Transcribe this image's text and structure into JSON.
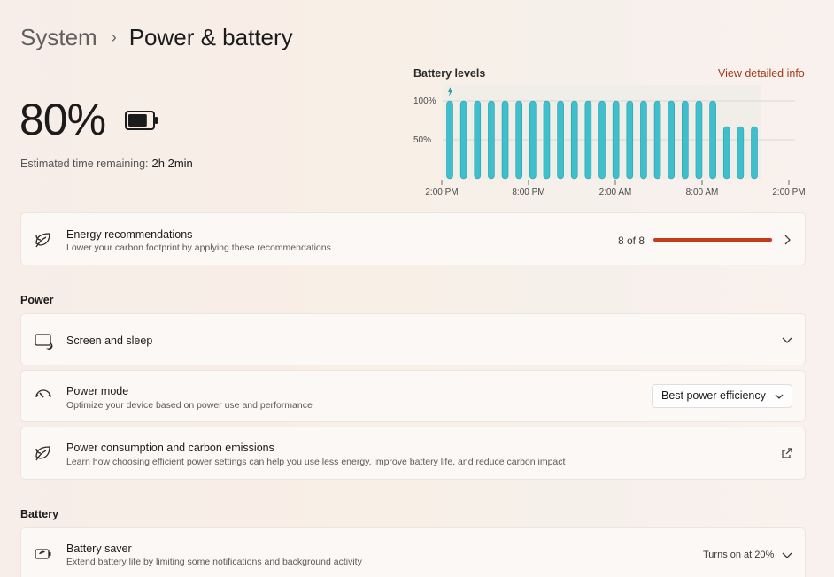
{
  "breadcrumb": {
    "parent": "System",
    "separator": "›",
    "current": "Power & battery"
  },
  "battery": {
    "percent_label": "80%",
    "level": 0.8,
    "estimate_label": "Estimated time remaining:",
    "estimate_value": "2h 2min"
  },
  "battery_chart": {
    "title": "Battery levels",
    "link": "View detailed info"
  },
  "chart_data": {
    "type": "bar",
    "title": "Battery levels",
    "xlabel": "",
    "ylabel": "",
    "ylim": [
      0,
      100
    ],
    "yticks": [
      "100%",
      "50%"
    ],
    "xticks": [
      "2:00 PM",
      "8:00 PM",
      "2:00 AM",
      "8:00 AM",
      "2:00 PM"
    ],
    "charging_marker": "first-bar",
    "color": "#3fbfcb",
    "values": [
      100,
      100,
      100,
      100,
      100,
      100,
      100,
      100,
      100,
      100,
      100,
      100,
      100,
      100,
      100,
      100,
      100,
      100,
      100,
      100,
      67,
      67,
      67
    ],
    "grid": true
  },
  "energy_recommendations": {
    "title": "Energy recommendations",
    "subtitle": "Lower your carbon footprint by applying these recommendations",
    "progress_label": "8 of 8",
    "progress": 1.0,
    "accent": "#c63a1b"
  },
  "power_section": {
    "label": "Power",
    "screen_sleep": {
      "title": "Screen and sleep"
    },
    "power_mode": {
      "title": "Power mode",
      "subtitle": "Optimize your device based on power use and performance",
      "selected": "Best power efficiency"
    },
    "consumption": {
      "title": "Power consumption and carbon emissions",
      "subtitle": "Learn how choosing efficient power settings can help you use less energy, improve battery life, and reduce carbon impact"
    }
  },
  "battery_section": {
    "label": "Battery",
    "saver": {
      "title": "Battery saver",
      "subtitle": "Extend battery life by limiting some notifications and background activity",
      "status": "Turns on at 20%"
    }
  },
  "icons": {
    "battery": "battery-icon",
    "leaf": "leaf-icon",
    "screen_sleep": "screen-sleep-icon",
    "power_mode": "gauge-icon",
    "external": "external-link-icon",
    "saver": "battery-saver-icon"
  }
}
